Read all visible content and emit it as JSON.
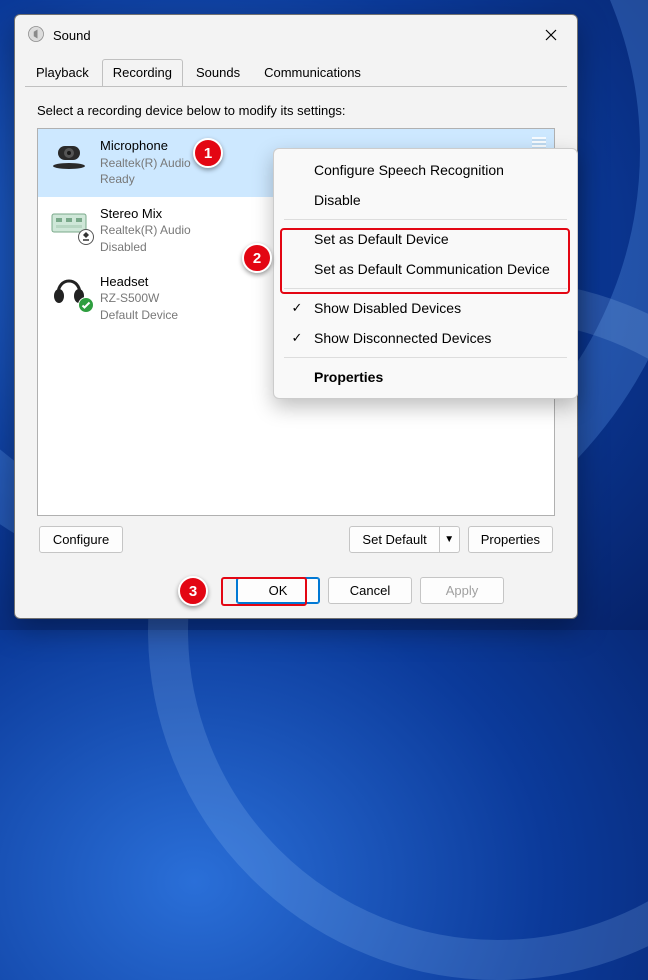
{
  "window": {
    "title": "Sound"
  },
  "tabs": [
    "Playback",
    "Recording",
    "Sounds",
    "Communications"
  ],
  "active_tab_index": 1,
  "instruction": "Select a recording device below to modify its settings:",
  "devices": [
    {
      "name": "Microphone",
      "driver": "Realtek(R) Audio",
      "status": "Ready",
      "selected": true,
      "has_meter": true
    },
    {
      "name": "Stereo Mix",
      "driver": "Realtek(R) Audio",
      "status": "Disabled",
      "overlay": "disabled"
    },
    {
      "name": "Headset",
      "driver": "RZ-S500W",
      "status": "Default Device",
      "overlay": "check"
    }
  ],
  "buttons": {
    "configure": "Configure",
    "set_default": "Set Default",
    "properties": "Properties",
    "ok": "OK",
    "cancel": "Cancel",
    "apply": "Apply"
  },
  "context_menu": {
    "items": [
      {
        "label": "Configure Speech Recognition"
      },
      {
        "label": "Disable"
      },
      {
        "sep": true
      },
      {
        "label": "Set as Default Device"
      },
      {
        "label": "Set as Default Communication Device"
      },
      {
        "sep": true
      },
      {
        "label": "Show Disabled Devices",
        "checked": true
      },
      {
        "label": "Show Disconnected Devices",
        "checked": true
      },
      {
        "sep": true
      },
      {
        "label": "Properties",
        "bold": true
      }
    ]
  },
  "annotations": {
    "1": "1",
    "2": "2",
    "3": "3"
  }
}
